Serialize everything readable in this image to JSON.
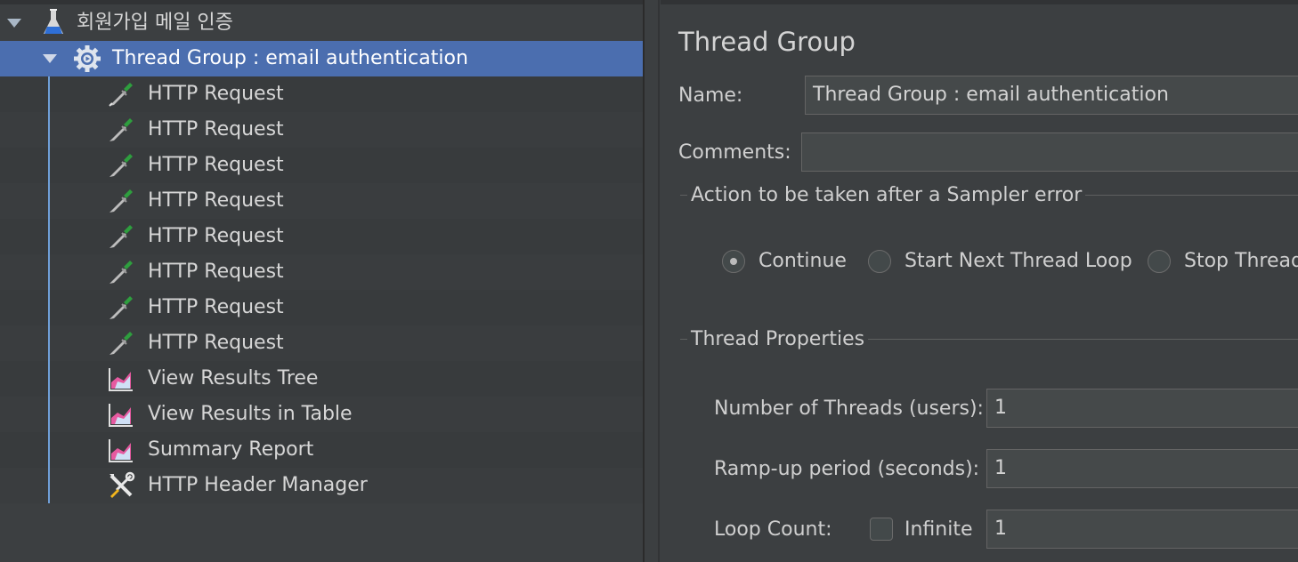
{
  "tree": {
    "root": {
      "label": "회원가입 메일 인증",
      "icon": "test-plan-flask-icon"
    },
    "thread_group": {
      "label": "Thread Group : email authentication",
      "icon": "gear-icon"
    },
    "children": [
      {
        "label": "HTTP Request",
        "icon": "pipette-icon"
      },
      {
        "label": "HTTP Request",
        "icon": "pipette-icon"
      },
      {
        "label": "HTTP Request",
        "icon": "pipette-icon"
      },
      {
        "label": "HTTP Request",
        "icon": "pipette-icon"
      },
      {
        "label": "HTTP Request",
        "icon": "pipette-icon"
      },
      {
        "label": "HTTP Request",
        "icon": "pipette-icon"
      },
      {
        "label": "HTTP Request",
        "icon": "pipette-icon"
      },
      {
        "label": "HTTP Request",
        "icon": "pipette-icon"
      },
      {
        "label": "View Results Tree",
        "icon": "listener-chart-icon"
      },
      {
        "label": "View Results in Table",
        "icon": "listener-chart-icon"
      },
      {
        "label": "Summary Report",
        "icon": "listener-chart-icon"
      },
      {
        "label": "HTTP Header Manager",
        "icon": "tools-wrench-icon"
      }
    ]
  },
  "editor": {
    "title": "Thread Group",
    "name_label": "Name:",
    "name_value": "Thread Group : email authentication",
    "comments_label": "Comments:",
    "comments_value": "",
    "sampler_error_title": "Action to be taken after a Sampler error",
    "sampler_error_options": [
      {
        "label": "Continue",
        "selected": true
      },
      {
        "label": "Start Next Thread Loop",
        "selected": false
      },
      {
        "label": "Stop Thread",
        "selected": false
      }
    ],
    "thread_properties_title": "Thread Properties",
    "threads_label": "Number of Threads (users):",
    "threads_value": "1",
    "rampup_label": "Ramp-up period (seconds):",
    "rampup_value": "1",
    "loop_label": "Loop Count:",
    "infinite_label": "Infinite",
    "infinite_checked": false,
    "loop_value": "1"
  },
  "colors": {
    "background": "#3c3f41",
    "selection": "#4b6eaf",
    "tree_line": "#6f9fd8"
  }
}
